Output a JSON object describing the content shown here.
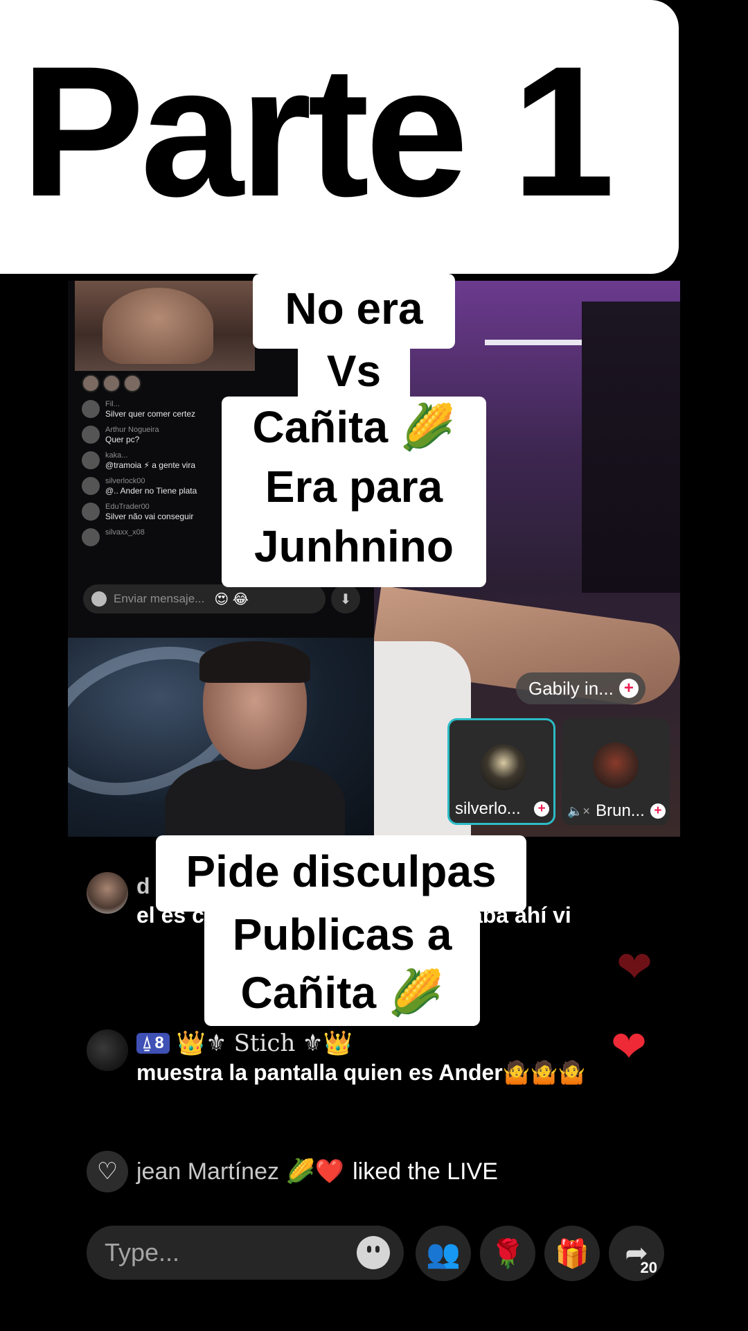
{
  "title": "Parte 1",
  "captions": {
    "top": [
      "No era",
      "Vs",
      "Cañita 🌽",
      "Era para",
      "Junhnino"
    ],
    "bottom": [
      "Pide disculpas",
      "Publicas a",
      "Cañita 🌽"
    ]
  },
  "embedded_chat": {
    "messages": [
      {
        "name": "Fil...",
        "text": "Silver quer comer certez"
      },
      {
        "name": "Arthur Nogueira",
        "text": "Quer pc?"
      },
      {
        "name": "kaka...",
        "text": "@tramoia ⚡ a gente vira"
      },
      {
        "name": "silverlock00",
        "text": "@.. Ander no Tiene plata"
      },
      {
        "name": "EduTrader00",
        "text": "Silver não vai conseguir"
      },
      {
        "name": "silvaxx_x08",
        "text": ""
      }
    ],
    "input_placeholder": "Enviar mensaje...",
    "emojis": "😍 😂",
    "download_icon": "⬇"
  },
  "guests": {
    "tag_label": "Gabily in...",
    "cards": [
      {
        "label": "silverlo..."
      },
      {
        "label": "Brun...",
        "muted_icon": "🔈×"
      }
    ]
  },
  "comments": [
    {
      "name": "d",
      "text": "el es caña hizo una b 30M el estaba ahí vi"
    },
    {
      "badge_level": "8",
      "badge_icon": "⍙",
      "name_decor_left": "👑⚜",
      "name": "Stich",
      "name_decor_right": "⚜👑",
      "text": "muestra la pantalla quien es Ander🤷🤷🤷"
    }
  ],
  "like_event": {
    "icon": "♡",
    "name": "jean Martínez 🌽❤️",
    "text": "liked the LIVE"
  },
  "bottom_bar": {
    "input_placeholder": "Type...",
    "buttons": [
      {
        "icon": "👥"
      },
      {
        "icon": "🌹"
      },
      {
        "icon": "🎁"
      },
      {
        "icon": "➦",
        "count": "20"
      }
    ]
  },
  "colors": {
    "like_heart": "#ee2a36",
    "badge": "#3f51b5",
    "active_guest_border": "#2bbcc6",
    "plus_accent": "#ee1d52"
  }
}
